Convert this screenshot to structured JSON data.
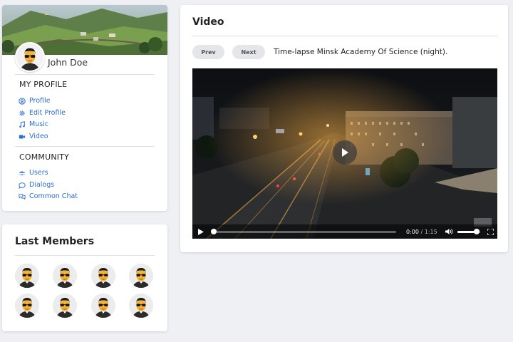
{
  "profile": {
    "name": "John Doe",
    "sections": [
      {
        "title": "MY PROFILE",
        "items": [
          {
            "label": "Profile",
            "icon": "user-circle-icon"
          },
          {
            "label": "Edit Profile",
            "icon": "gear-icon"
          },
          {
            "label": "Music",
            "icon": "music-note-icon"
          },
          {
            "label": "Video",
            "icon": "video-camera-icon"
          }
        ]
      },
      {
        "title": "COMMUNITY",
        "items": [
          {
            "label": "Users",
            "icon": "users-icon"
          },
          {
            "label": "Dialogs",
            "icon": "speech-bubble-icon"
          },
          {
            "label": "Common Chat",
            "icon": "chat-bubbles-icon"
          }
        ]
      }
    ]
  },
  "members": {
    "title": "Last Members",
    "count": 8
  },
  "video": {
    "title": "Video",
    "prev_label": "Prev",
    "next_label": "Next",
    "caption": "Time-lapse Minsk Academy Of Science (night).",
    "player": {
      "current_time": "0:00",
      "duration": "/ 1:15",
      "progress": 0,
      "volume": 0.85
    }
  },
  "colors": {
    "link": "#2c6fd1",
    "background": "#eef0f3"
  }
}
